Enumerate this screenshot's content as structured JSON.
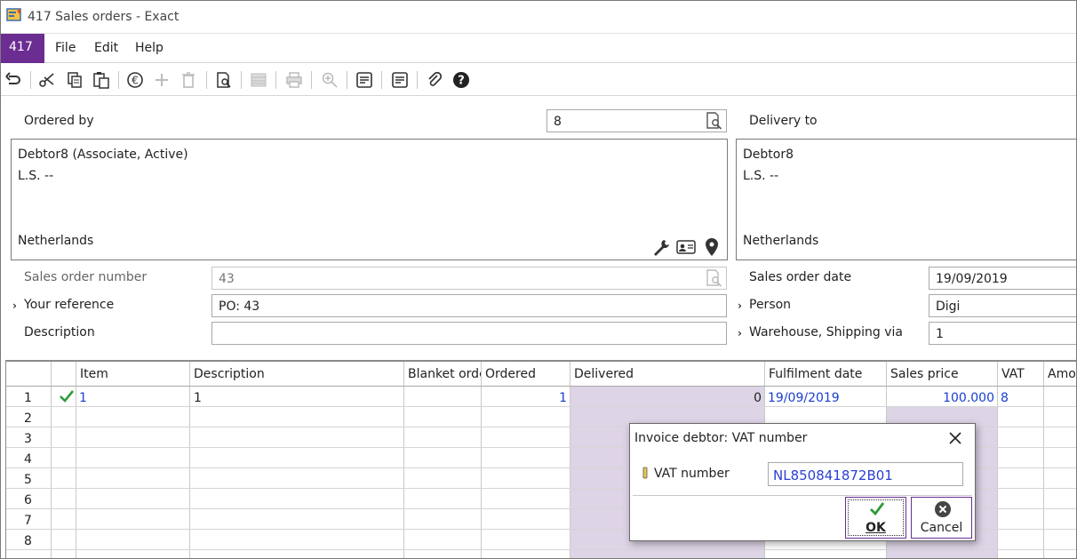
{
  "window": {
    "title": "417 Sales orders - Exact"
  },
  "menubar": {
    "badge": "417",
    "items": [
      "File",
      "Edit",
      "Help"
    ]
  },
  "toolbar": {
    "icons": [
      "undo-icon",
      "cut-icon",
      "copy-icon",
      "paste-icon",
      "euro-icon",
      "add-icon",
      "delete-icon",
      "preview-icon",
      "list-icon",
      "print-icon",
      "zoom-icon",
      "notes-icon",
      "notes2-icon",
      "attachment-icon",
      "help-icon"
    ]
  },
  "form": {
    "ordered_by_label": "Ordered by",
    "ordered_by_value": "8",
    "delivery_to_label": "Delivery to",
    "ordered_address": {
      "name": "Debtor8 (Associate, Active)",
      "line2": "L.S. --",
      "country": "Netherlands"
    },
    "delivery_address": {
      "name": "Debtor8",
      "line2": "L.S. --",
      "country": "Netherlands"
    },
    "sales_order_number_label": "Sales order number",
    "sales_order_number": "43",
    "your_reference_label": "Your reference",
    "your_reference": "PO: 43",
    "description_label": "Description",
    "description": "",
    "sales_order_date_label": "Sales order date",
    "sales_order_date": "19/09/2019",
    "person_label": "Person",
    "person": "Digi",
    "warehouse_label": "Warehouse, Shipping via",
    "warehouse": "1"
  },
  "grid": {
    "headers": [
      "Item",
      "Description",
      "Blanket orde",
      "Ordered",
      "Delivered",
      "Fulfilment date",
      "Sales price",
      "VAT",
      "Amou"
    ],
    "row_numbers": [
      "1",
      "2",
      "3",
      "4",
      "5",
      "6",
      "7",
      "8"
    ],
    "rows": [
      {
        "item": "1",
        "description": "1",
        "ordered": "1",
        "delivered": "0",
        "fulfilment_date": "19/09/2019",
        "sales_price": "100.000",
        "vat": "8"
      }
    ]
  },
  "dialog": {
    "title": "Invoice debtor: VAT number",
    "field_label": "VAT number",
    "field_value": "NL850841872B01",
    "ok_label": "OK",
    "cancel_label": "Cancel"
  },
  "colors": {
    "brand": "#6b2d91",
    "link_blue": "#1a3fd0",
    "shade": "#ddd4e6"
  }
}
